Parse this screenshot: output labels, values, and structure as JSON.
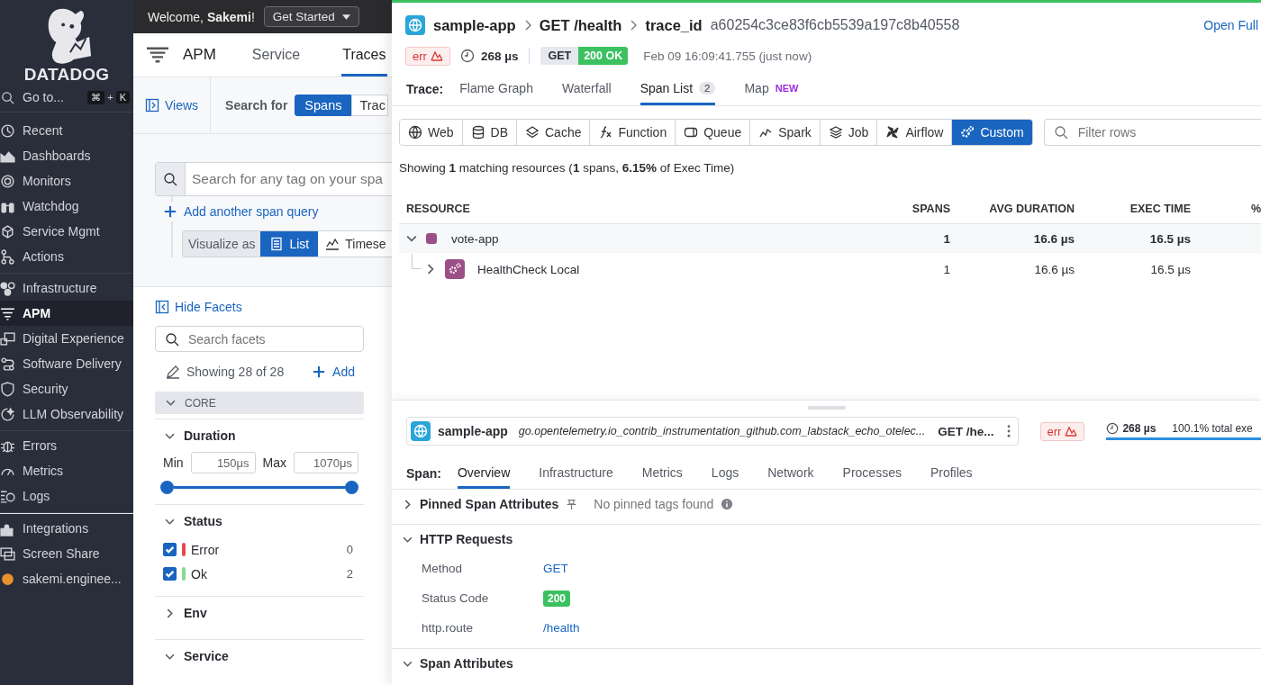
{
  "sidebar": {
    "logo_text": "DATADOG",
    "goto": {
      "label": "Go to...",
      "keys": [
        "⌘",
        "+",
        "K"
      ]
    },
    "groups": [
      {
        "items": [
          {
            "label": "Recent",
            "selected": false
          },
          {
            "label": "Dashboards",
            "selected": false
          },
          {
            "label": "Monitors",
            "selected": false
          },
          {
            "label": "Watchdog",
            "selected": false
          },
          {
            "label": "Service Mgmt",
            "selected": false
          },
          {
            "label": "Actions",
            "selected": false
          }
        ]
      },
      {
        "items": [
          {
            "label": "Infrastructure",
            "selected": false
          },
          {
            "label": "APM",
            "selected": true
          },
          {
            "label": "Digital Experience",
            "selected": false
          },
          {
            "label": "Software Delivery",
            "selected": false
          },
          {
            "label": "Security",
            "selected": false
          },
          {
            "label": "LLM Observability",
            "selected": false
          }
        ]
      },
      {
        "items": [
          {
            "label": "Errors",
            "selected": false
          },
          {
            "label": "Metrics",
            "selected": false
          },
          {
            "label": "Logs",
            "selected": false
          }
        ]
      },
      {
        "items": [
          {
            "label": "Integrations",
            "selected": false
          },
          {
            "label": "Screen Share",
            "selected": false
          },
          {
            "label": "sakemi.enginee...",
            "selected": false
          }
        ]
      }
    ]
  },
  "topbar": {
    "welcome": "Welcome, **Sakemi**!",
    "button": "Get Started"
  },
  "apm": {
    "title": "APM",
    "tabs": [
      {
        "label": "Service",
        "selected": false
      },
      {
        "label": "Traces",
        "selected": true
      }
    ],
    "views": "Views",
    "search_for": "Search for",
    "search_modes": [
      {
        "label": "Spans",
        "selected": true
      },
      {
        "label": "Trac",
        "selected": false
      }
    ],
    "search": {
      "placeholder": "Search for any tag on your spa"
    },
    "add_query": "Add another span query",
    "visualize_label": "Visualize as",
    "visualize_modes": [
      {
        "label": "List",
        "selected": true
      },
      {
        "label": "Timese",
        "selected": false
      }
    ]
  },
  "facets": {
    "hide": "Hide Facets",
    "search": {
      "placeholder": "Search facets"
    },
    "showing": "Showing 28 of 28",
    "add": "Add",
    "core": "CORE",
    "duration": {
      "title": "Duration",
      "expanded": true,
      "min_label": "Min",
      "min": "150μs",
      "max_label": "Max",
      "max": "1070μs",
      "level": 1
    },
    "status": {
      "title": "Status",
      "expanded": true,
      "items": [
        {
          "label": "Error",
          "count": "0",
          "checked": true,
          "color": "#e5484d"
        },
        {
          "label": "Ok",
          "count": "2",
          "checked": true,
          "color": "#86d993"
        }
      ]
    },
    "sections": [
      {
        "title": "Env",
        "expanded": false
      },
      {
        "title": "Service",
        "expanded": true
      }
    ]
  },
  "trace": {
    "breadcrumb": [
      "sample-app",
      "GET /health"
    ],
    "id_label": "trace_id",
    "id": "a60254c3ce83f6cb5539a197c8b40558",
    "open_full": "Open Full",
    "err": "err",
    "duration": "268 µs",
    "method": "GET",
    "status": "200 OK",
    "timestamp": "Feb 09 16:09:41.755 (just now)",
    "tabs_label": "Trace:",
    "tabs": [
      {
        "label": "Flame Graph",
        "selected": false
      },
      {
        "label": "Waterfall",
        "selected": false
      },
      {
        "label": "Span List",
        "count": "2",
        "selected": true
      },
      {
        "label": "Map",
        "badge": "NEW",
        "selected": false
      }
    ],
    "filters": [
      {
        "label": "Web",
        "selected": false
      },
      {
        "label": "DB",
        "selected": false
      },
      {
        "label": "Cache",
        "selected": false
      },
      {
        "label": "Function",
        "selected": false
      },
      {
        "label": "Queue",
        "selected": false
      },
      {
        "label": "Spark",
        "selected": false
      },
      {
        "label": "Job",
        "selected": false
      },
      {
        "label": "Airflow",
        "selected": false
      },
      {
        "label": "Custom",
        "selected": true
      }
    ],
    "filter_rows": {
      "placeholder": "Filter rows"
    },
    "summary": "Showing **1** matching resources (**1** spans, **6.15%** of Exec Time)",
    "table": {
      "columns": [
        "RESOURCE",
        "SPANS",
        "AVG DURATION",
        "EXEC TIME",
        "%"
      ],
      "rows": [
        {
          "name": "vote-app",
          "spans": "1",
          "avg_duration": "16.6 µs",
          "exec_time": "16.5 µs",
          "expanded": true,
          "color": "#9c4f86",
          "children": [
            {
              "name": "HealthCheck Local",
              "spans": "1",
              "avg_duration": "16.6 µs",
              "exec_time": "16.5 µs",
              "expanded": false,
              "color": "#9c4f86"
            }
          ]
        }
      ]
    }
  },
  "span": {
    "service": "sample-app",
    "resource": "go.opentelemetry.io_contrib_instrumentation_github.com_labstack_echo_otelec...",
    "operation": "GET /he...",
    "err": "err",
    "duration": "268 µs",
    "total": "100.1% total exe",
    "level": 1,
    "tabs_label": "Span:",
    "tabs": [
      {
        "label": "Overview",
        "selected": true
      },
      {
        "label": "Infrastructure",
        "selected": false
      },
      {
        "label": "Metrics",
        "selected": false
      },
      {
        "label": "Logs",
        "selected": false
      },
      {
        "label": "Network",
        "selected": false
      },
      {
        "label": "Processes",
        "selected": false
      },
      {
        "label": "Profiles",
        "selected": false
      }
    ],
    "pinned": {
      "title": "Pinned Span Attributes",
      "expanded": false,
      "empty": "No pinned tags found"
    },
    "http": {
      "title": "HTTP Requests",
      "expanded": true,
      "rows": [
        {
          "key": "Method",
          "value": "GET",
          "kind": "link"
        },
        {
          "key": "Status Code",
          "value": "200",
          "kind": "badge"
        },
        {
          "key": "http.route",
          "value": "/health",
          "kind": "link"
        }
      ]
    },
    "attributes": {
      "title": "Span Attributes",
      "expanded": true
    }
  }
}
